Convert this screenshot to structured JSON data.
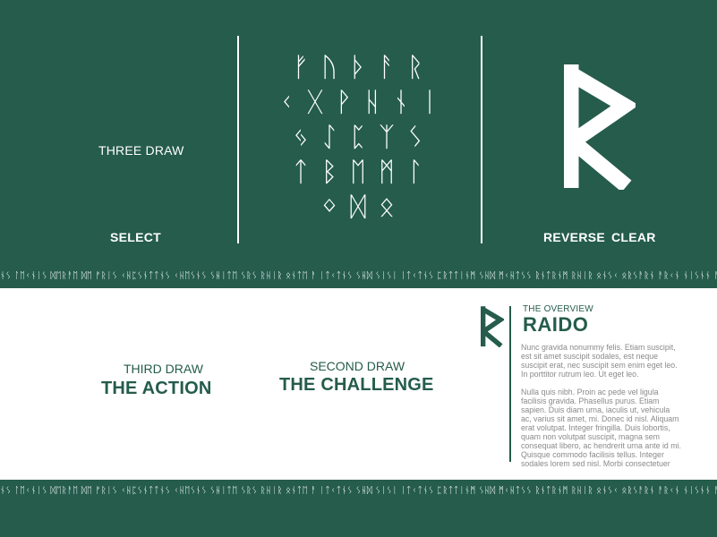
{
  "top": {
    "mode_label": "THREE DRAW",
    "select_label": "SELECT",
    "reverse_label": "REVERSE",
    "clear_label": "CLEAR"
  },
  "runes": {
    "rows": [
      [
        "ᚠ",
        "ᚢ",
        "ᚦ",
        "ᚨ",
        "ᚱ"
      ],
      [
        "ᚲ",
        "ᚷ",
        "ᚹ",
        "ᚺ",
        "ᚾ",
        "ᛁ"
      ],
      [
        "ᛃ",
        "ᛇ",
        "ᛈ",
        "ᛉ",
        "ᛊ"
      ],
      [
        "ᛏ",
        "ᛒ",
        "ᛖ",
        "ᛗ",
        "ᛚ"
      ],
      [
        "ᛜ",
        "ᛞ",
        "ᛟ"
      ]
    ]
  },
  "selected_rune": {
    "icon": "raido-rune-icon"
  },
  "strip_text": "ᚾᛊ ᛚᛖᚲᚾᛁᛊ ᛞᛖᚱᚨᛖ ᛞᛖ ᚠᚱᛁᛊ ᚲᚺᛈᛊᚾᛏᛏᚾᛊ ᚲᚺᛖᛊᚾᛊ ᛊᚺᛁᛏᛖ ᛊᚱᛊ ᚱᚺᛁᚱ ᛟᚾᛏᛖ ᚨ ᛁᛏᚲᛏᚾᛊ ᛊᚺᛞ ᛊᛁᛊᛁ ᛁᛏᚲᛏᚾᛊ ᛈᚱᛏᛏᛁᚾᛗ ᛊᚺᛞ ᛗᚲᚺᛏᛊᛊ ᚱᚾᛏᚱᚾᛗ ᚱᚺᛁᚱ ᛟᚾᛊᚲ ᛟᚱᛊᚨᚱᚾ ᚨᚱᚲᚾ ᚾᛁᛊᚾᚾ ᚨᛏ ᚨᚾᛊᚾᚾ ᚨᚲ ᛗᚨᚲᛊᚨ ᛊᚱᛁᛏᛁᚲᛁᛏᚾᛗᛁᛊ ᛊᚲᛗᚨᛏᚾᛊ ᛗᛖᛊᚺᛁᚲ ᛊᚺᛁᛏᛖ ᛊᛖᛈᛏ",
  "draws": [
    {
      "label": "THIRD DRAW",
      "title": "THE ACTION"
    },
    {
      "label": "SECOND DRAW",
      "title": "THE CHALLENGE"
    }
  ],
  "overview": {
    "kicker": "THE OVERVIEW",
    "name": "RAIDO",
    "p1": "Nunc gravida nonummy felis. Etiam suscipit, est sit amet suscipit sodales, est neque suscipit erat, nec suscipit sem enim eget leo. In porttitor rutrum leo. Ut eget leo.",
    "p2": "Nulla quis nibh. Proin ac pede vel ligula facilisis gravida. Phasellus purus. Etiam sapien. Duis diam urna, iaculis ut, vehicula ac, varius sit amet, mi. Donec id nisl. Aliquam erat volutpat. Integer fringilla. Duis lobortis, quam non volutpat suscipit, magna sem consequat libero, ac hendrerit urna ante id mi. Quisque commodo facilisis tellus. Integer sodales lorem sed nisl. Morbi consectetuer"
  },
  "colors": {
    "bg_green": "#255c4c",
    "panel_white": "#ffffff",
    "body_gray": "#8a8a8a"
  }
}
